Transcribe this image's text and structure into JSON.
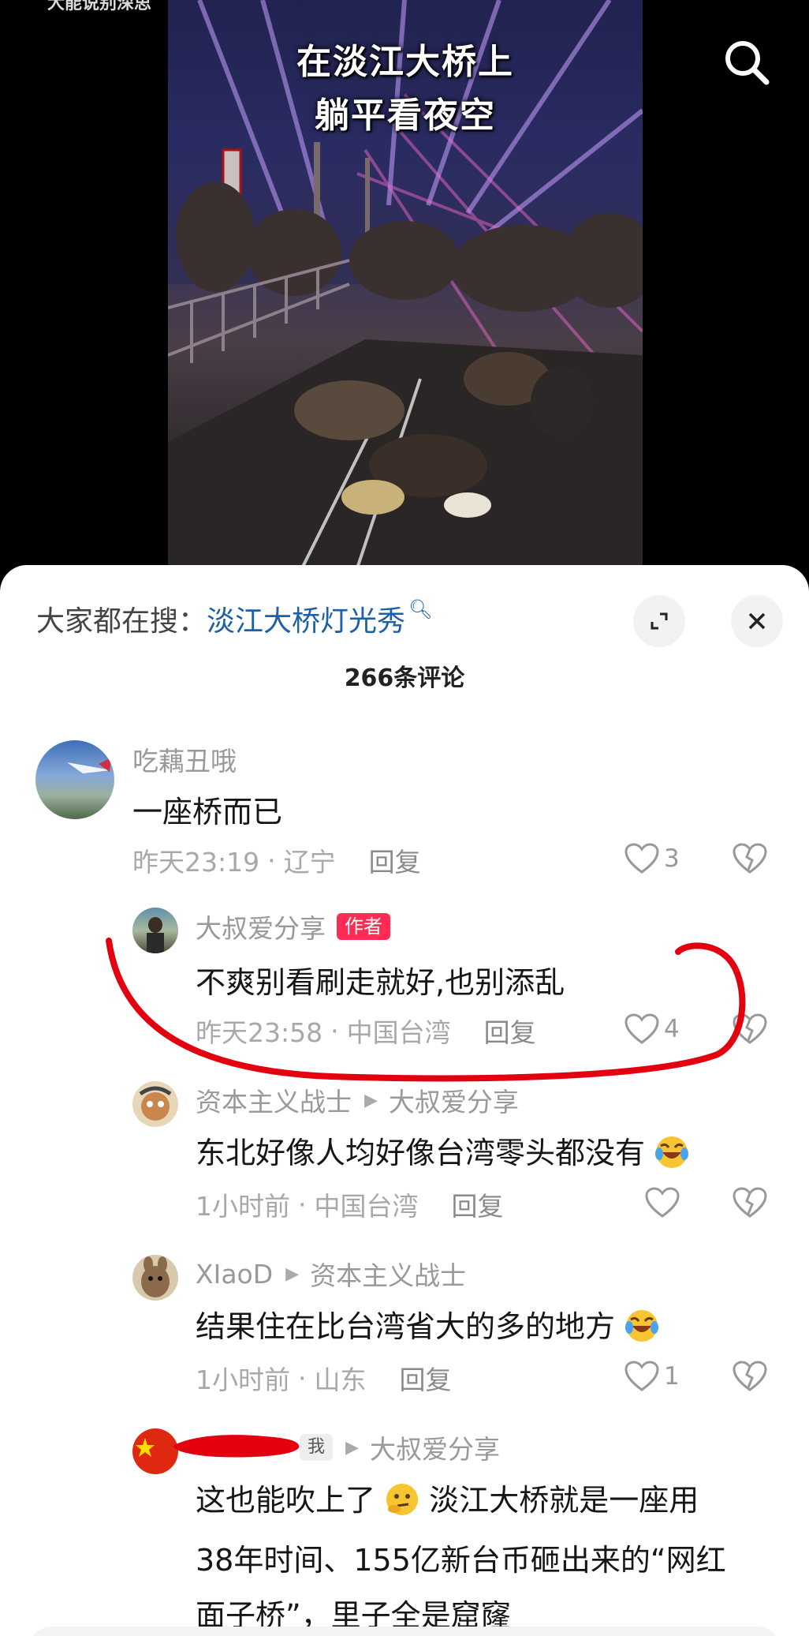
{
  "video": {
    "top_left_text": "大能说别深思",
    "caption_line1": "在淡江大桥上",
    "caption_line2": "躺平看夜空"
  },
  "sheet": {
    "search_label": "大家都在搜：",
    "search_term": "淡江大桥灯光秀",
    "search_term_icon": "search-small-icon",
    "comment_count": "266条评论"
  },
  "comments": [
    {
      "username": "吃藕丑哦",
      "text": "一座桥而已",
      "time": "昨天23:19",
      "location": "辽宁",
      "reply_label": "回复",
      "likes": "3"
    },
    {
      "username": "大叔爱分享",
      "badge": "作者",
      "text": "不爽别看刷走就好,也别添乱",
      "time": "昨天23:58",
      "location": "中国台湾",
      "reply_label": "回复",
      "likes": "4"
    },
    {
      "username": "资本主义战士",
      "reply_to": "大叔爱分享",
      "text": "东北好像人均好像台湾零头都没有",
      "time": "1小时前",
      "location": "中国台湾",
      "reply_label": "回复",
      "likes": ""
    },
    {
      "username": "XIaoD",
      "reply_to": "资本主义战士",
      "text": "结果住在比台湾省大的多的地方",
      "time": "1小时前",
      "location": "山东",
      "reply_label": "回复",
      "likes": "1"
    },
    {
      "me_badge": "我",
      "reply_to": "大叔爱分享",
      "text_line1_a": "这也能吹上了",
      "text_line1_b": "淡江大桥就是一座用",
      "text_line2": "38年时间、155亿新台币砸出来的“网红",
      "text_line3": "面子桥”，里子全是窟窿"
    }
  ],
  "colors": {
    "author_badge": "#fe2c55",
    "search_term": "#1d5fa8",
    "annotation": "#e3000f"
  }
}
